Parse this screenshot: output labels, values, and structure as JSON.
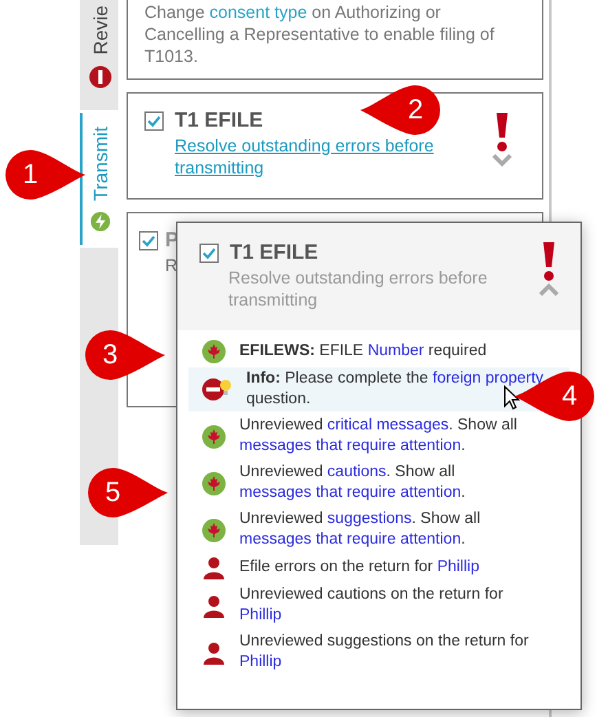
{
  "side_tabs": [
    {
      "label": "Revie",
      "kind": "error",
      "selected": false
    },
    {
      "label": "Transmit",
      "kind": "ok",
      "selected": true
    }
  ],
  "cards": [
    {
      "parts": [
        {
          "text": "Change ",
          "kind": "text"
        },
        {
          "text": "consent type",
          "kind": "link"
        },
        {
          "text": " on Authorizing or Cancelling a Representative to enable filing of T1013.",
          "kind": "text"
        }
      ]
    },
    {
      "title": "T1 EFILE",
      "checked": true,
      "link": "Resolve outstanding errors before transmitting",
      "alert": true,
      "expanded": false
    },
    {
      "title": "P",
      "checked": true,
      "subtitle": "R"
    }
  ],
  "popup": {
    "title": "T1 EFILE",
    "checked": true,
    "subtitle": "Resolve outstanding errors before transmitting",
    "alert": true,
    "expanded": true,
    "messages": [
      {
        "kind": "maple",
        "highlighted": false,
        "parts": [
          {
            "text": "**EFILEWS:** EFILE ",
            "kind": "text"
          },
          {
            "text": "Number",
            "kind": "link"
          },
          {
            "text": " required",
            "kind": "text"
          }
        ]
      },
      {
        "kind": "stop",
        "highlighted": true,
        "parts": [
          {
            "text": "**Info:** Please complete the ",
            "kind": "text"
          },
          {
            "text": "foreign",
            "kind": "link"
          },
          {
            "text": " property",
            "kind": "link"
          },
          {
            "text": " question.",
            "kind": "text"
          }
        ]
      },
      {
        "kind": "maple",
        "highlighted": false,
        "parts": [
          {
            "text": "Unreviewed ",
            "kind": "text"
          },
          {
            "text": "critical messages",
            "kind": "link"
          },
          {
            "text": ". Show all ",
            "kind": "text"
          },
          {
            "text": "messages that require attention",
            "kind": "link"
          },
          {
            "text": ".",
            "kind": "text"
          }
        ]
      },
      {
        "kind": "maple",
        "highlighted": false,
        "parts": [
          {
            "text": "Unreviewed ",
            "kind": "text"
          },
          {
            "text": "cautions",
            "kind": "link"
          },
          {
            "text": ". Show all ",
            "kind": "text"
          },
          {
            "text": "messages",
            "kind": "link"
          },
          {
            "text": " that require attention",
            "kind": "link"
          },
          {
            "text": ".",
            "kind": "text"
          }
        ]
      },
      {
        "kind": "maple",
        "highlighted": false,
        "parts": [
          {
            "text": "Unreviewed ",
            "kind": "text"
          },
          {
            "text": "suggestions",
            "kind": "link"
          },
          {
            "text": ". Show all ",
            "kind": "text"
          },
          {
            "text": "messages that require attention",
            "kind": "link"
          },
          {
            "text": ".",
            "kind": "text"
          }
        ]
      },
      {
        "kind": "person",
        "highlighted": false,
        "parts": [
          {
            "text": "Efile errors on the return for ",
            "kind": "text"
          },
          {
            "text": "Phillip",
            "kind": "link"
          }
        ]
      },
      {
        "kind": "person",
        "highlighted": false,
        "parts": [
          {
            "text": "Unreviewed cautions on the return for ",
            "kind": "text"
          },
          {
            "text": "Phillip",
            "kind": "link"
          }
        ]
      },
      {
        "kind": "person",
        "highlighted": false,
        "parts": [
          {
            "text": "Unreviewed suggestions on the return for ",
            "kind": "text"
          },
          {
            "text": "Phillip",
            "kind": "link"
          }
        ]
      }
    ]
  },
  "callouts": [
    {
      "label": "1"
    },
    {
      "label": "2"
    },
    {
      "label": "3"
    },
    {
      "label": "4"
    },
    {
      "label": "5"
    }
  ]
}
